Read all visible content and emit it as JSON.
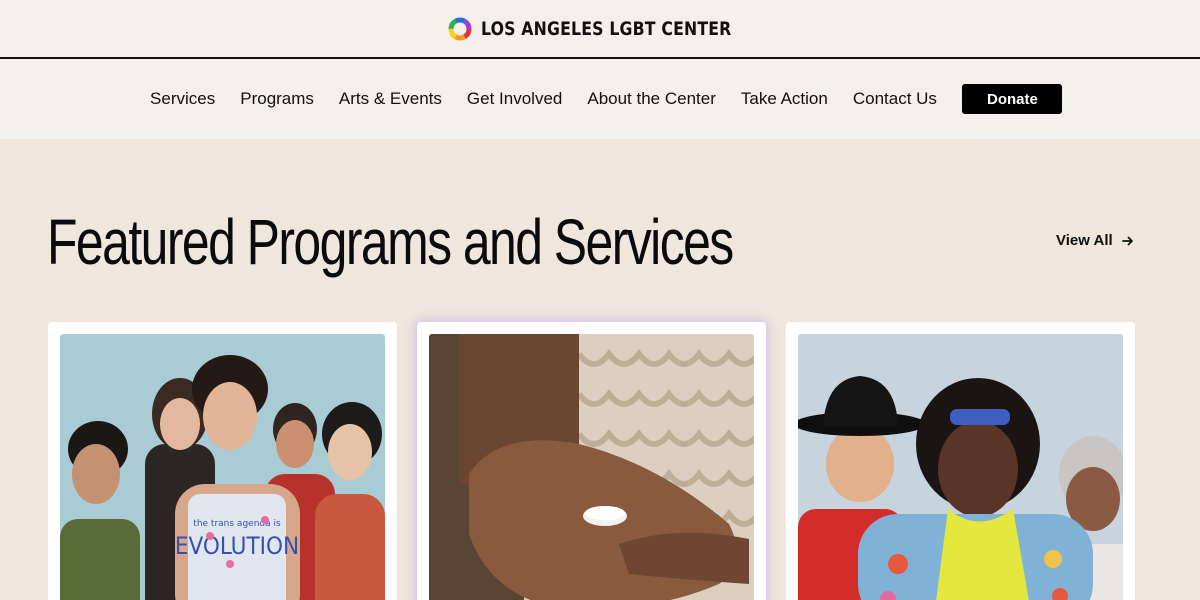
{
  "header": {
    "logo_text": "LOS ANGELES LGBT CENTER",
    "logo_icon": "rainbow-ring-icon"
  },
  "nav": {
    "items": [
      {
        "label": "Services"
      },
      {
        "label": "Programs"
      },
      {
        "label": "Arts & Events"
      },
      {
        "label": "Get Involved"
      },
      {
        "label": "About the Center"
      },
      {
        "label": "Take Action"
      },
      {
        "label": "Contact Us"
      }
    ],
    "donate_label": "Donate"
  },
  "featured": {
    "title": "Featured Programs and Services",
    "view_all_label": "View All",
    "view_all_icon": "arrow-right-icon",
    "cards": [
      {
        "image": "group-of-young-people-photo",
        "tank_text_small": "the trans agenda is",
        "tank_text_big": "EVOLUTION"
      },
      {
        "image": "hand-holding-pill-photo"
      },
      {
        "image": "older-adults-portrait-photo"
      }
    ]
  },
  "colors": {
    "page_bg": "#efe6de",
    "header_bg": "#f3efea",
    "text": "#111111",
    "donate_bg": "#000000",
    "card_bg": "#ffffff"
  }
}
